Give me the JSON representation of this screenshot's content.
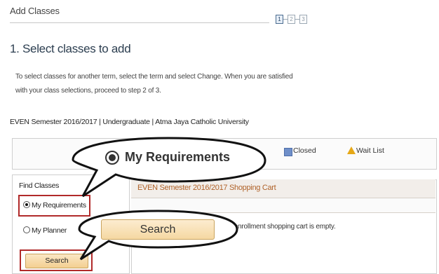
{
  "header": {
    "title": "Add Classes",
    "steps": [
      "1",
      "2",
      "3"
    ]
  },
  "section": {
    "title": "1.  Select classes to add"
  },
  "instructions": {
    "line1": "To select classes for another term, select the term and select Change.  When you are satisfied",
    "line2": "with your class selections, proceed to step 2 of 3."
  },
  "term": "EVEN Semester 2016/2017 | Undergraduate | Atma Jaya Catholic University",
  "legend": {
    "closed": "Closed",
    "wait_list": "Wait List",
    "closed_color": "#6f8fc9",
    "wait_color": "#e6a817"
  },
  "find_classes": {
    "label": "Find Classes",
    "options": [
      "My Requirements",
      "My Planner"
    ],
    "selected": "My Requirements",
    "search_label": "Search"
  },
  "cart": {
    "title": "EVEN Semester 2016/2017 Shopping Cart",
    "empty_message": "r enrollment shopping cart is empty."
  },
  "callouts": {
    "requirements": "My Requirements",
    "search": "Search"
  },
  "colors": {
    "highlight_border": "#b12a2a",
    "button_fill": "#f3cf91",
    "cart_title": "#b0632a"
  }
}
